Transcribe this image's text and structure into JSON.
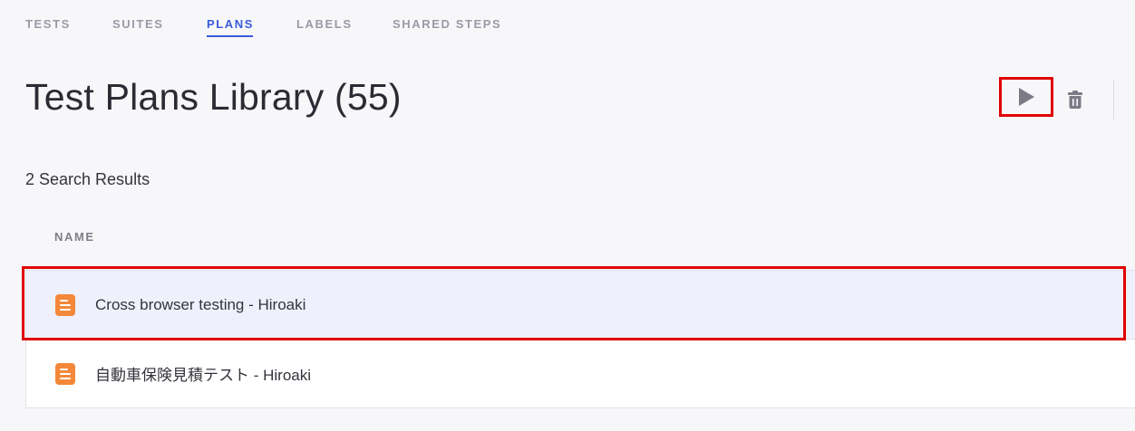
{
  "tabs": [
    {
      "label": "TESTS",
      "active": false
    },
    {
      "label": "SUITES",
      "active": false
    },
    {
      "label": "PLANS",
      "active": true
    },
    {
      "label": "LABELS",
      "active": false
    },
    {
      "label": "SHARED STEPS",
      "active": false
    }
  ],
  "header": {
    "title": "Test Plans Library (55)"
  },
  "toolbar": {
    "run_icon": "play-icon",
    "delete_icon": "trash-icon"
  },
  "results": {
    "count_text": "2 Search Results"
  },
  "table": {
    "column_name": "NAME",
    "rows": [
      {
        "name": "Cross browser testing - Hiroaki",
        "icon": "test-plan-icon",
        "selected": true
      },
      {
        "name": "自動車保険見積テスト - Hiroaki",
        "icon": "test-plan-icon",
        "selected": false
      }
    ]
  },
  "colors": {
    "accent": "#3b5bdb",
    "highlight": "#e00000",
    "plan_icon": "#f4883a",
    "selected_row": "#eef0fb"
  }
}
